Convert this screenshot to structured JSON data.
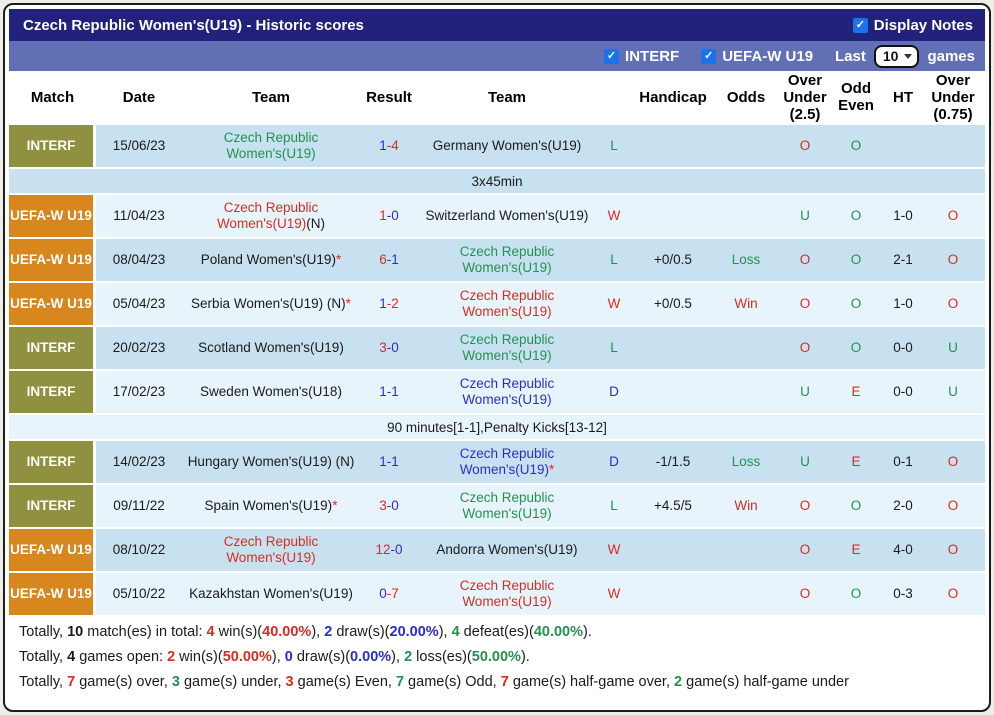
{
  "palette": {
    "red": "#d92b21",
    "green": "#23914e",
    "blue": "#2c2ccd",
    "title_bar": "#22227c",
    "filter_bar": "#6170b5",
    "badge_interf": "#8f9140",
    "badge_uefa": "#d7871e",
    "row_dark": "#c8e1f1",
    "row_light": "#e8f4fb",
    "checkbox_blue": "#1a73e8"
  },
  "header": {
    "title": "Czech Republic Women's(U19) - Historic scores",
    "display_notes_label": "Display Notes",
    "display_notes_checked": true
  },
  "filters": {
    "interf_label": "INTERF",
    "interf_checked": true,
    "uefa_label": "UEFA-W U19",
    "uefa_checked": true,
    "last_label": "Last",
    "last_value": "10",
    "games_label": "games"
  },
  "table": {
    "columns": [
      "Match",
      "Date",
      "Team",
      "Result",
      "Team",
      "",
      "Handicap",
      "Odds",
      "Over\nUnder\n(2.5)",
      "Odd\nEven",
      "HT",
      "Over\nUnder\n(0.75)"
    ],
    "rows": [
      {
        "league": "INTERF",
        "date": "15/06/23",
        "home": [
          {
            "t": "Czech Republic Women's(U19)",
            "c": "green"
          }
        ],
        "score": {
          "h": "1",
          "hc": "blue",
          "a": "4",
          "ac": "red"
        },
        "away": [
          {
            "t": "Germany Women's(U19)",
            "c": "black"
          }
        ],
        "wld": {
          "t": "L",
          "c": "green"
        },
        "handicap": "",
        "odds": {
          "t": "",
          "c": "black"
        },
        "ou25": {
          "t": "O",
          "c": "red"
        },
        "oddeven": {
          "t": "O",
          "c": "green"
        },
        "ht": "",
        "ou075": {
          "t": "",
          "c": "red"
        },
        "note": "3x45min"
      },
      {
        "league": "UEFA-W U19",
        "date": "11/04/23",
        "home": [
          {
            "t": "Czech Republic Women's(U19)",
            "c": "red"
          },
          {
            "t": "(N)",
            "c": "black"
          }
        ],
        "score": {
          "h": "1",
          "hc": "red",
          "a": "0",
          "ac": "blue"
        },
        "away": [
          {
            "t": "Switzerland Women's(U19)",
            "c": "black"
          }
        ],
        "wld": {
          "t": "W",
          "c": "red"
        },
        "handicap": "",
        "odds": {
          "t": "",
          "c": "black"
        },
        "ou25": {
          "t": "U",
          "c": "green"
        },
        "oddeven": {
          "t": "O",
          "c": "green"
        },
        "ht": "1-0",
        "ou075": {
          "t": "O",
          "c": "red"
        }
      },
      {
        "league": "UEFA-W U19",
        "date": "08/04/23",
        "home": [
          {
            "t": "Poland Women's(U19)",
            "c": "black"
          },
          {
            "t": "*",
            "c": "red"
          }
        ],
        "score": {
          "h": "6",
          "hc": "red",
          "a": "1",
          "ac": "blue"
        },
        "away": [
          {
            "t": "Czech Republic Women's(U19)",
            "c": "green"
          }
        ],
        "wld": {
          "t": "L",
          "c": "green"
        },
        "handicap": "+0/0.5",
        "odds": {
          "t": "Loss",
          "c": "green"
        },
        "ou25": {
          "t": "O",
          "c": "red"
        },
        "oddeven": {
          "t": "O",
          "c": "green"
        },
        "ht": "2-1",
        "ou075": {
          "t": "O",
          "c": "red"
        }
      },
      {
        "league": "UEFA-W U19",
        "date": "05/04/23",
        "home": [
          {
            "t": "Serbia Women's(U19) (N)",
            "c": "black"
          },
          {
            "t": "*",
            "c": "red"
          }
        ],
        "score": {
          "h": "1",
          "hc": "blue",
          "a": "2",
          "ac": "red"
        },
        "away": [
          {
            "t": "Czech Republic Women's(U19)",
            "c": "red"
          }
        ],
        "wld": {
          "t": "W",
          "c": "red"
        },
        "handicap": "+0/0.5",
        "odds": {
          "t": "Win",
          "c": "red"
        },
        "ou25": {
          "t": "O",
          "c": "red"
        },
        "oddeven": {
          "t": "O",
          "c": "green"
        },
        "ht": "1-0",
        "ou075": {
          "t": "O",
          "c": "red"
        }
      },
      {
        "league": "INTERF",
        "date": "20/02/23",
        "home": [
          {
            "t": "Scotland Women's(U19)",
            "c": "black"
          }
        ],
        "score": {
          "h": "3",
          "hc": "red",
          "a": "0",
          "ac": "blue"
        },
        "away": [
          {
            "t": "Czech Republic Women's(U19)",
            "c": "green"
          }
        ],
        "wld": {
          "t": "L",
          "c": "green"
        },
        "handicap": "",
        "odds": {
          "t": "",
          "c": "black"
        },
        "ou25": {
          "t": "O",
          "c": "red"
        },
        "oddeven": {
          "t": "O",
          "c": "green"
        },
        "ht": "0-0",
        "ou075": {
          "t": "U",
          "c": "green"
        }
      },
      {
        "league": "INTERF",
        "date": "17/02/23",
        "home": [
          {
            "t": "Sweden Women's(U18)",
            "c": "black"
          }
        ],
        "score": {
          "h": "1",
          "hc": "blue",
          "a": "1",
          "ac": "blue"
        },
        "away": [
          {
            "t": "Czech Republic Women's(U19)",
            "c": "blue"
          }
        ],
        "wld": {
          "t": "D",
          "c": "blue"
        },
        "handicap": "",
        "odds": {
          "t": "",
          "c": "black"
        },
        "ou25": {
          "t": "U",
          "c": "green"
        },
        "oddeven": {
          "t": "E",
          "c": "red"
        },
        "ht": "0-0",
        "ou075": {
          "t": "U",
          "c": "green"
        },
        "note": "90 minutes[1-1],Penalty Kicks[13-12]"
      },
      {
        "league": "INTERF",
        "date": "14/02/23",
        "home": [
          {
            "t": "Hungary Women's(U19) (N)",
            "c": "black"
          }
        ],
        "score": {
          "h": "1",
          "hc": "blue",
          "a": "1",
          "ac": "blue"
        },
        "away": [
          {
            "t": "Czech Republic Women's(U19)",
            "c": "blue"
          },
          {
            "t": "*",
            "c": "red"
          }
        ],
        "wld": {
          "t": "D",
          "c": "blue"
        },
        "handicap": "-1/1.5",
        "odds": {
          "t": "Loss",
          "c": "green"
        },
        "ou25": {
          "t": "U",
          "c": "green"
        },
        "oddeven": {
          "t": "E",
          "c": "red"
        },
        "ht": "0-1",
        "ou075": {
          "t": "O",
          "c": "red"
        }
      },
      {
        "league": "INTERF",
        "date": "09/11/22",
        "home": [
          {
            "t": "Spain Women's(U19)",
            "c": "black"
          },
          {
            "t": "*",
            "c": "red"
          }
        ],
        "score": {
          "h": "3",
          "hc": "red",
          "a": "0",
          "ac": "blue"
        },
        "away": [
          {
            "t": "Czech Republic Women's(U19)",
            "c": "green"
          }
        ],
        "wld": {
          "t": "L",
          "c": "green"
        },
        "handicap": "+4.5/5",
        "odds": {
          "t": "Win",
          "c": "red"
        },
        "ou25": {
          "t": "O",
          "c": "red"
        },
        "oddeven": {
          "t": "O",
          "c": "green"
        },
        "ht": "2-0",
        "ou075": {
          "t": "O",
          "c": "red"
        }
      },
      {
        "league": "UEFA-W U19",
        "date": "08/10/22",
        "home": [
          {
            "t": "Czech Republic Women's(U19)",
            "c": "red"
          }
        ],
        "score": {
          "h": "12",
          "hc": "red",
          "a": "0",
          "ac": "blue"
        },
        "away": [
          {
            "t": "Andorra Women's(U19)",
            "c": "black"
          }
        ],
        "wld": {
          "t": "W",
          "c": "red"
        },
        "handicap": "",
        "odds": {
          "t": "",
          "c": "black"
        },
        "ou25": {
          "t": "O",
          "c": "red"
        },
        "oddeven": {
          "t": "E",
          "c": "red"
        },
        "ht": "4-0",
        "ou075": {
          "t": "O",
          "c": "red"
        }
      },
      {
        "league": "UEFA-W U19",
        "date": "05/10/22",
        "home": [
          {
            "t": "Kazakhstan Women's(U19)",
            "c": "black"
          }
        ],
        "score": {
          "h": "0",
          "hc": "blue",
          "a": "7",
          "ac": "red"
        },
        "away": [
          {
            "t": "Czech Republic Women's(U19)",
            "c": "red"
          }
        ],
        "wld": {
          "t": "W",
          "c": "red"
        },
        "handicap": "",
        "odds": {
          "t": "",
          "c": "black"
        },
        "ou25": {
          "t": "O",
          "c": "red"
        },
        "oddeven": {
          "t": "O",
          "c": "green"
        },
        "ht": "0-3",
        "ou075": {
          "t": "O",
          "c": "red"
        }
      }
    ]
  },
  "summary": {
    "lines": [
      [
        {
          "t": "Totally, "
        },
        {
          "t": "10",
          "b": 1
        },
        {
          "t": " match(es) in total: "
        },
        {
          "t": "4",
          "c": "red",
          "b": 1
        },
        {
          "t": " win(s)("
        },
        {
          "t": "40.00%",
          "c": "red",
          "b": 1
        },
        {
          "t": "), "
        },
        {
          "t": "2",
          "c": "blue",
          "b": 1
        },
        {
          "t": " draw(s)("
        },
        {
          "t": "20.00%",
          "c": "blue",
          "b": 1
        },
        {
          "t": "), "
        },
        {
          "t": "4",
          "c": "green",
          "b": 1
        },
        {
          "t": " defeat(es)("
        },
        {
          "t": "40.00%",
          "c": "green",
          "b": 1
        },
        {
          "t": ")."
        }
      ],
      [
        {
          "t": "Totally, "
        },
        {
          "t": "4",
          "b": 1
        },
        {
          "t": " games open: "
        },
        {
          "t": "2",
          "c": "red",
          "b": 1
        },
        {
          "t": " win(s)("
        },
        {
          "t": "50.00%",
          "c": "red",
          "b": 1
        },
        {
          "t": "), "
        },
        {
          "t": "0",
          "c": "blue",
          "b": 1
        },
        {
          "t": " draw(s)("
        },
        {
          "t": "0.00%",
          "c": "blue",
          "b": 1
        },
        {
          "t": "), "
        },
        {
          "t": "2",
          "c": "green",
          "b": 1
        },
        {
          "t": " loss(es)("
        },
        {
          "t": "50.00%",
          "c": "green",
          "b": 1
        },
        {
          "t": ")."
        }
      ],
      [
        {
          "t": "Totally, "
        },
        {
          "t": "7",
          "c": "red",
          "b": 1
        },
        {
          "t": " game(s) over, "
        },
        {
          "t": "3",
          "c": "green",
          "b": 1
        },
        {
          "t": " game(s) under, "
        },
        {
          "t": "3",
          "c": "red",
          "b": 1
        },
        {
          "t": " game(s) Even, "
        },
        {
          "t": "7",
          "c": "green",
          "b": 1
        },
        {
          "t": " game(s) Odd, "
        },
        {
          "t": "7",
          "c": "red",
          "b": 1
        },
        {
          "t": " game(s) half-game over, "
        },
        {
          "t": "2",
          "c": "green",
          "b": 1
        },
        {
          "t": " game(s) half-game under"
        }
      ]
    ]
  }
}
